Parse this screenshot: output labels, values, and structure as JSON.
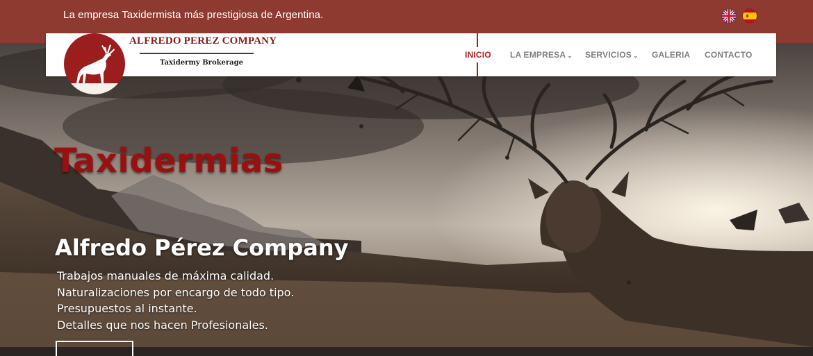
{
  "topbar": {
    "text": "La empresa Taxidermista más prestigiosa de Argentina.",
    "languages": [
      {
        "name": "English",
        "icon": "uk-flag-icon"
      },
      {
        "name": "Español",
        "icon": "spain-flag-icon"
      }
    ]
  },
  "brand": {
    "title": "ALFREDO PEREZ COMPANY",
    "subtitle": "Taxidermy Brokerage",
    "logo_icon": "deer-icon"
  },
  "nav": {
    "items": [
      {
        "label": "INICIO",
        "active": true,
        "dropdown": false
      },
      {
        "label": "LA EMPRESA",
        "active": false,
        "dropdown": true
      },
      {
        "label": "SERVICIOS",
        "active": false,
        "dropdown": true
      },
      {
        "label": "GALERIA",
        "active": false,
        "dropdown": false
      },
      {
        "label": "CONTACTO",
        "active": false,
        "dropdown": false
      }
    ],
    "caret": "⌄"
  },
  "hero": {
    "title": "Taxidermias",
    "subtitle": "Alfredo Pérez Company",
    "lines": [
      "Trabajos manuales de máxima calidad.",
      "Naturalizaciones por encargo de todo tipo.",
      "Presupuestos al instante.",
      "Detalles que nos hacen Profesionales."
    ]
  },
  "colors": {
    "topbar_bg": "#8e3a30",
    "accent": "#b01d1d",
    "brand_red": "#9c1d1d",
    "nav_text": "#7f7f7f"
  }
}
